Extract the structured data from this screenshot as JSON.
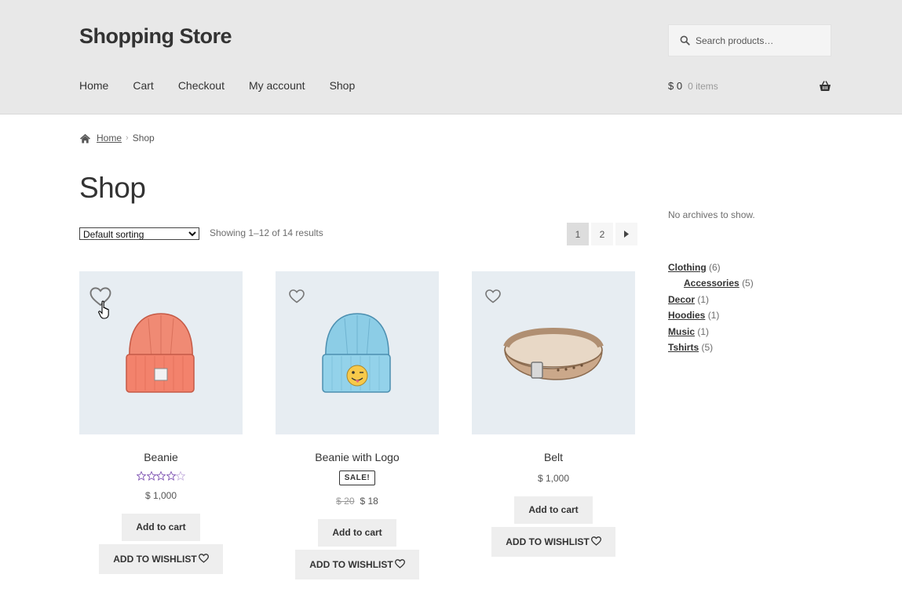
{
  "header": {
    "site_title": "Shopping Store",
    "search_placeholder": "Search products…",
    "nav": [
      "Home",
      "Cart",
      "Checkout",
      "My account",
      "Shop"
    ],
    "cart_amount": "$ 0",
    "cart_count": "0 items"
  },
  "breadcrumb": {
    "home": "Home",
    "current": "Shop"
  },
  "page_title": "Shop",
  "toolbar": {
    "orderby_selected": "Default sorting",
    "result_count": "Showing 1–12 of 14 results",
    "pages": [
      "1",
      "2"
    ]
  },
  "products": [
    {
      "title": "Beanie",
      "rating_stars": 3.5,
      "price": "$ 1,000",
      "add_to_cart": "Add to cart",
      "wishlist": "ADD TO WISHLIST",
      "image_icon": "beanie-red"
    },
    {
      "title": "Beanie with Logo",
      "sale_badge": "SALE!",
      "regular_price": "$ 20",
      "price": "$ 18",
      "add_to_cart": "Add to cart",
      "wishlist": "ADD TO WISHLIST",
      "image_icon": "beanie-blue-logo"
    },
    {
      "title": "Belt",
      "price": "$ 1,000",
      "add_to_cart": "Add to cart",
      "wishlist": "ADD TO WISHLIST",
      "image_icon": "leather-belt"
    }
  ],
  "sidebar": {
    "no_archives": "No archives to show.",
    "categories": [
      {
        "name": "Clothing",
        "count": "(6)"
      },
      {
        "name": "Accessories",
        "count": "(5)",
        "child": true
      },
      {
        "name": "Decor",
        "count": "(1)"
      },
      {
        "name": "Hoodies",
        "count": "(1)"
      },
      {
        "name": "Music",
        "count": "(1)"
      },
      {
        "name": "Tshirts",
        "count": "(5)"
      }
    ]
  },
  "colors": {
    "header_bg": "#e8e8e8",
    "thumb_bg": "#e7edf2",
    "button_bg": "#eeeeee",
    "star_purple": "#7f54b3"
  }
}
